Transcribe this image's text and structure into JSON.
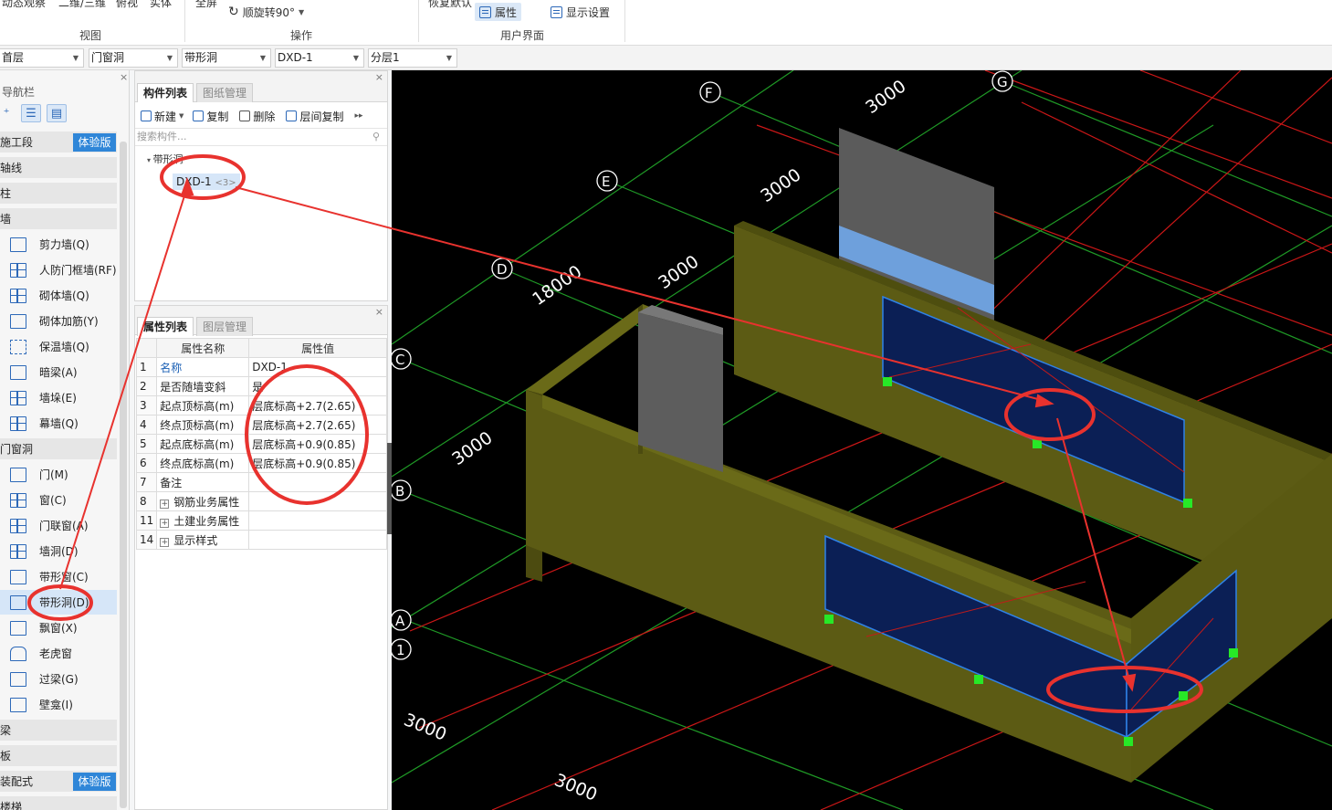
{
  "ribbon": {
    "top_items": [
      "动态观察",
      "二维/三维",
      "俯视",
      "实体",
      "全屏",
      "恢复默认"
    ],
    "rotate_label": "顺旋转90°",
    "attr_label": "属性",
    "display_settings": "显示设置",
    "groups": {
      "view": "视图",
      "operate": "操作",
      "ui": "用户界面"
    }
  },
  "filters": {
    "floor": "首层",
    "category": "门窗洞",
    "type": "带形洞",
    "component": "DXD-1",
    "layer": "分层1"
  },
  "nav": {
    "title": "导航栏",
    "badge": "体验版",
    "categories": [
      "施工段",
      "轴线",
      "柱",
      "墙"
    ],
    "wall_items": [
      "剪力墙(Q)",
      "人防门框墙(RF)",
      "砌体墙(Q)",
      "砌体加筋(Y)",
      "保温墙(Q)",
      "暗梁(A)",
      "墙垛(E)",
      "幕墙(Q)"
    ],
    "door_cat": "门窗洞",
    "door_items": [
      "门(M)",
      "窗(C)",
      "门联窗(A)",
      "墙洞(D)",
      "带形窗(C)",
      "带形洞(D)",
      "飘窗(X)",
      "老虎窗",
      "过梁(G)",
      "壁龛(I)"
    ],
    "bottom_cats": [
      "梁",
      "板",
      "装配式",
      "楼梯"
    ]
  },
  "complist": {
    "tabs": [
      "构件列表",
      "图纸管理"
    ],
    "toolbar": {
      "new": "新建",
      "copy": "复制",
      "delete": "删除",
      "floor_copy": "层间复制"
    },
    "search_placeholder": "搜索构件...",
    "tree_root": "带形洞",
    "tree_child": "DXD-1",
    "tree_child_count": "<3>"
  },
  "props": {
    "tabs": [
      "属性列表",
      "图层管理"
    ],
    "headers": {
      "name": "属性名称",
      "value": "属性值"
    },
    "rows": [
      {
        "num": "1",
        "name": "名称",
        "value": "DXD-1"
      },
      {
        "num": "2",
        "name": "是否随墙变斜",
        "value": "是"
      },
      {
        "num": "3",
        "name": "起点顶标高(m)",
        "value": "层底标高+2.7(2.65)"
      },
      {
        "num": "4",
        "name": "终点顶标高(m)",
        "value": "层底标高+2.7(2.65)"
      },
      {
        "num": "5",
        "name": "起点底标高(m)",
        "value": "层底标高+0.9(0.85)"
      },
      {
        "num": "6",
        "name": "终点底标高(m)",
        "value": "层底标高+0.9(0.85)"
      },
      {
        "num": "7",
        "name": "备注",
        "value": ""
      },
      {
        "num": "8",
        "name": "钢筋业务属性",
        "value": ""
      },
      {
        "num": "11",
        "name": "土建业务属性",
        "value": ""
      },
      {
        "num": "14",
        "name": "显示样式",
        "value": ""
      }
    ]
  },
  "viewport": {
    "axis_letters": [
      "F",
      "G",
      "E",
      "D",
      "C",
      "B",
      "A",
      "1"
    ],
    "dims": [
      "3000",
      "3000",
      "3000",
      "18000",
      "3000",
      "3000",
      "3000"
    ]
  },
  "colors": {
    "accent": "#2f86d8",
    "wall": "#5b5a14",
    "annotation": "#e8322e",
    "grid_red": "#d01818",
    "grid_green": "#22a52a",
    "opening": "#0b1f55"
  }
}
